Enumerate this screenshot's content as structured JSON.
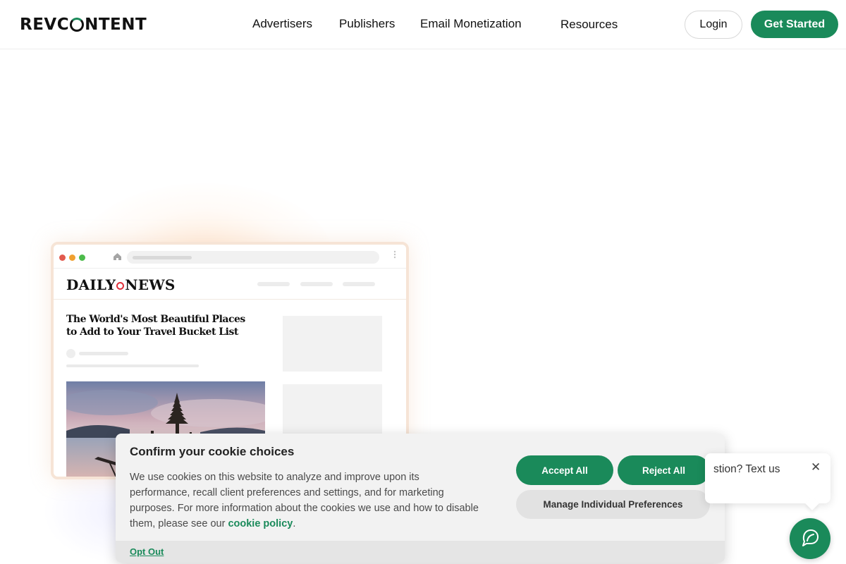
{
  "header": {
    "logo_prefix": "REVC",
    "logo_suffix": "NTENT",
    "nav": [
      "Advertisers",
      "Publishers",
      "Email Monetization",
      "Resources"
    ],
    "login_label": "Login",
    "get_started_label": "Get Started"
  },
  "mockup": {
    "brand_left": "DAILY",
    "brand_right": "NEWS",
    "headline": "The World's Most Beautiful Places to Add to Your Travel Bucket List"
  },
  "cookie": {
    "title": "Confirm your cookie choices",
    "body": "We use cookies on this website to analyze and improve upon its performance, recall client preferences and settings, and for marketing purposes. For more information about the cookies we use and how to disable them, please see our",
    "link_label": "cookie policy",
    "body_end": ".",
    "accept_label": "Accept All",
    "reject_label": "Reject All",
    "manage_label": "Manage Individual Preferences",
    "opt_out_label": "Opt Out"
  },
  "chat": {
    "teaser": "stion? Text us",
    "close_glyph": "✕"
  },
  "colors": {
    "brand_green": "#1a8a5a",
    "cookie_bg": "#f2f2f2",
    "mockup_border": "#f6e4d6"
  },
  "icons": [
    "home-icon",
    "kebab-menu-icon",
    "close-icon",
    "chat-icon"
  ]
}
